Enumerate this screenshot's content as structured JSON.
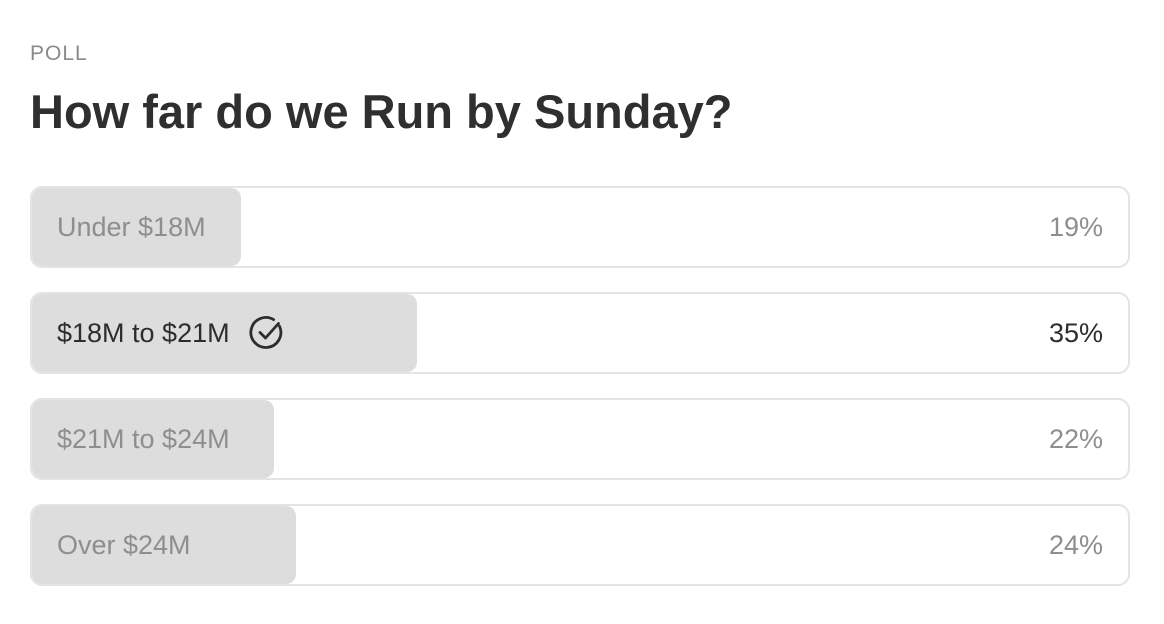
{
  "poll": {
    "label": "POLL",
    "question": "How far do we Run by Sunday?",
    "options": [
      {
        "label": "Under $18M",
        "percent_text": "19%",
        "share": 0.19,
        "selected": false
      },
      {
        "label": "$18M to $21M",
        "percent_text": "35%",
        "share": 0.35,
        "selected": true,
        "icon": "check-circle-icon"
      },
      {
        "label": "$21M to $24M",
        "percent_text": "22%",
        "share": 0.22,
        "selected": false
      },
      {
        "label": "Over $24M",
        "percent_text": "24%",
        "share": 0.24,
        "selected": false
      }
    ]
  },
  "colors": {
    "fill": "#dddddd",
    "border": "#e4e4e4",
    "text_muted": "#8e8e8e",
    "text_selected": "#2d2d2d",
    "heading": "#2f2f2f"
  }
}
